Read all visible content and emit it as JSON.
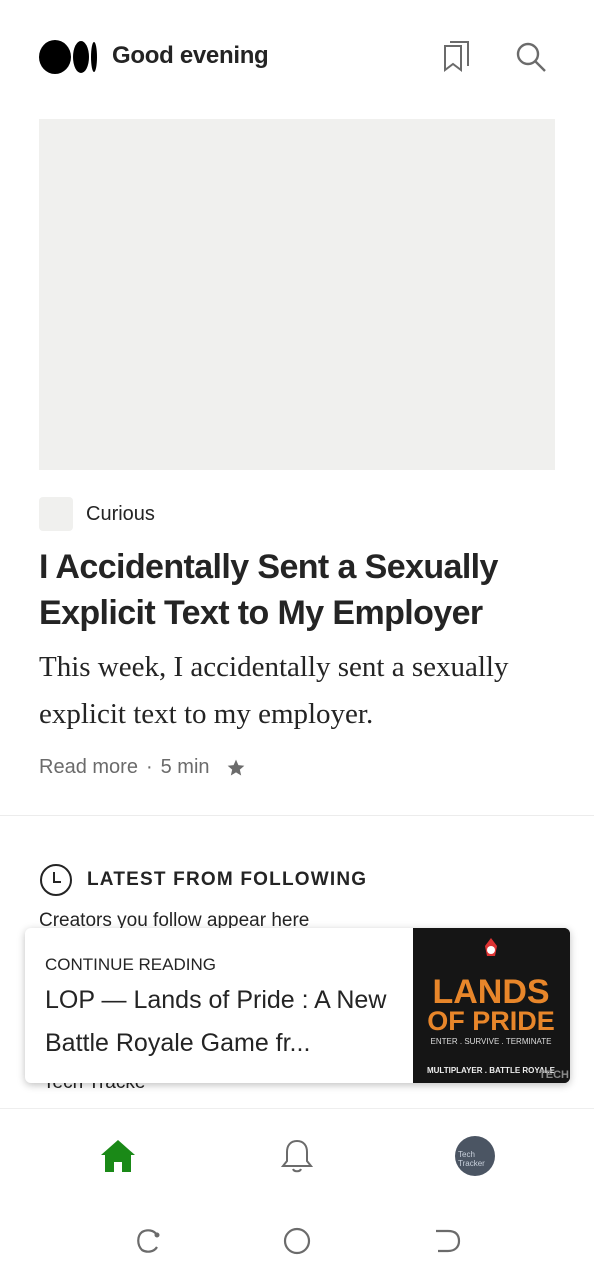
{
  "header": {
    "greeting": "Good evening",
    "icons": [
      "medium-logo",
      "reading-list-icon",
      "search-icon"
    ]
  },
  "featured": {
    "publication": "Curious",
    "title": "I Accidentally Sent a Sexually Explicit Text to My Employer",
    "subtitle": "This week, I accidentally sent a sexually explicit text to my employer.",
    "read_more": "Read more",
    "separator": "·",
    "read_time": "5 min"
  },
  "latest": {
    "label": "LATEST FROM FOLLOWING",
    "creators_text": "Creators you follow appear here",
    "peek_text": "Tech Tracke"
  },
  "continue_card": {
    "label": "CONTINUE READING",
    "title": "LOP — Lands of Pride : A New Battle Royale Game fr...",
    "thumb": {
      "heading_line1": "LANDS",
      "heading_line2": "OF PRIDE",
      "tagline": "ENTER . SURVIVE . TERMINATE",
      "footer": "MULTIPLAYER . BATTLE ROYALE",
      "watermark": "TECH",
      "accent_color": "#e8862a"
    }
  },
  "bottom_nav": {
    "active_color": "#1a8917",
    "items": [
      "home-icon",
      "notifications-icon",
      "profile-avatar"
    ],
    "avatar_text": "Tech Tracker"
  },
  "system_bar": {
    "items": [
      "recents-icon",
      "home-circle-icon",
      "back-icon"
    ]
  }
}
